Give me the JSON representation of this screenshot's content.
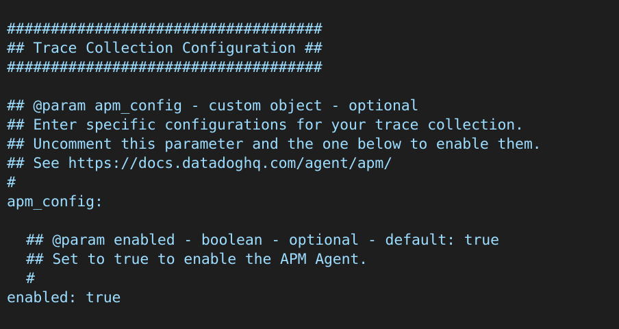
{
  "editor": {
    "lines": [
      "####################################",
      "## Trace Collection Configuration ##",
      "####################################",
      "",
      "## @param apm_config - custom object - optional",
      "## Enter specific configurations for your trace collection.",
      "## Uncomment this parameter and the one below to enable them.",
      "## See https://docs.datadoghq.com/agent/apm/",
      "#",
      "apm_config:",
      "",
      "## @param enabled - boolean - optional - default: true",
      "## Set to true to enable the APM Agent.",
      "#",
      "enabled: true"
    ]
  }
}
